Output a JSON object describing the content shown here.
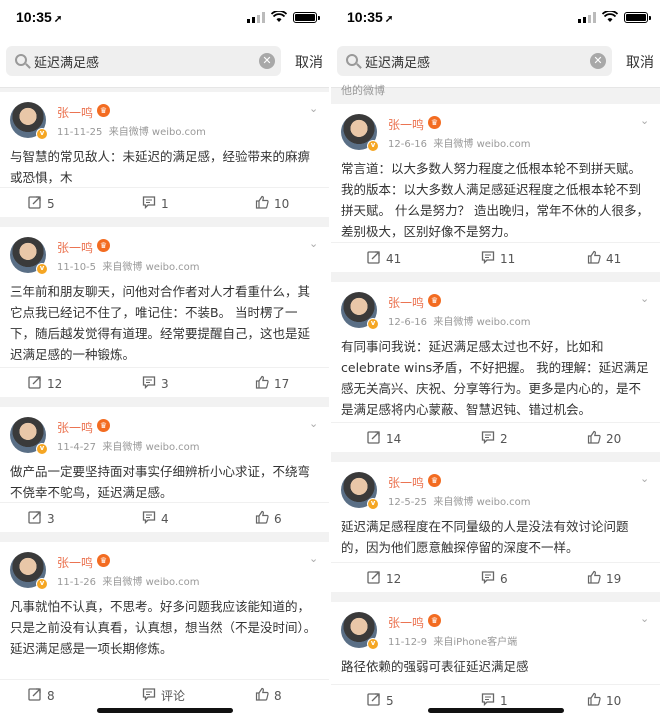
{
  "left": {
    "status": {
      "time": "10:35"
    },
    "search": {
      "query": "延迟满足感",
      "cancel": "取消"
    },
    "posts": [
      {
        "author": "张一鸣",
        "date": "11-11-25",
        "source": "来自微博 weibo.com",
        "text": "与智慧的常见敌人：未延迟的满足感，经验带来的麻痹或恐惧，木",
        "reposts": "5",
        "comments": "1",
        "likes": "10"
      },
      {
        "author": "张一鸣",
        "date": "11-10-5",
        "source": "来自微博 weibo.com",
        "text": "三年前和朋友聊天，问他对合作者对人才看重什么，其它点我已经记不住了，唯记住：不装B。 当时楞了一下，随后越发觉得有道理。经常要提醒自己，这也是延迟满足感的一种锻炼。",
        "reposts": "12",
        "comments": "3",
        "likes": "17"
      },
      {
        "author": "张一鸣",
        "date": "11-4-27",
        "source": "来自微博 weibo.com",
        "text": "做产品一定要坚持面对事实仔细辨析小心求证，不绕弯不侥幸不鸵鸟，延迟满足感。",
        "reposts": "3",
        "comments": "4",
        "likes": "6"
      },
      {
        "author": "张一鸣",
        "date": "11-1-26",
        "source": "来自微博 weibo.com",
        "text": "凡事就怕不认真，不思考。好多问题我应该能知道的，只是之前没有认真看，认真想，想当然（不是没时间）。延迟满足感是一项长期修炼。",
        "reposts": "8",
        "comments": "评论",
        "likes": "8"
      }
    ]
  },
  "right": {
    "status": {
      "time": "10:35"
    },
    "search": {
      "query": "延迟满足感",
      "cancel": "取消"
    },
    "partial_label": "他的微博",
    "posts": [
      {
        "author": "张一鸣",
        "date": "12-6-16",
        "source": "来自微博 weibo.com",
        "text": "常言道：以大多数人努力程度之低根本轮不到拼天赋。 我的版本：以大多数人满足感延迟程度之低根本轮不到拼天赋。 什么是努力？ 造出晚归，常年不休的人很多，差别极大，区别好像不是努力。",
        "reposts": "41",
        "comments": "11",
        "likes": "41"
      },
      {
        "author": "张一鸣",
        "date": "12-6-16",
        "source": "来自微博 weibo.com",
        "text": "有同事问我说：延迟满足感太过也不好，比如和celebrate wins矛盾，不好把握。 我的理解：延迟满足感无关高兴、庆祝、分享等行为。更多是内心的，是不是满足感将内心蒙蔽、智慧迟钝、错过机会。",
        "reposts": "14",
        "comments": "2",
        "likes": "20"
      },
      {
        "author": "张一鸣",
        "date": "12-5-25",
        "source": "来自微博 weibo.com",
        "text": "延迟满足感程度在不同量级的人是没法有效讨论问题的，因为他们愿意触探停留的深度不一样。",
        "reposts": "12",
        "comments": "6",
        "likes": "19"
      },
      {
        "author": "张一鸣",
        "date": "11-12-9",
        "source": "来自iPhone客户端",
        "text": "路径依赖的强弱可表征延迟满足感",
        "reposts": "5",
        "comments": "1",
        "likes": "10"
      }
    ]
  }
}
